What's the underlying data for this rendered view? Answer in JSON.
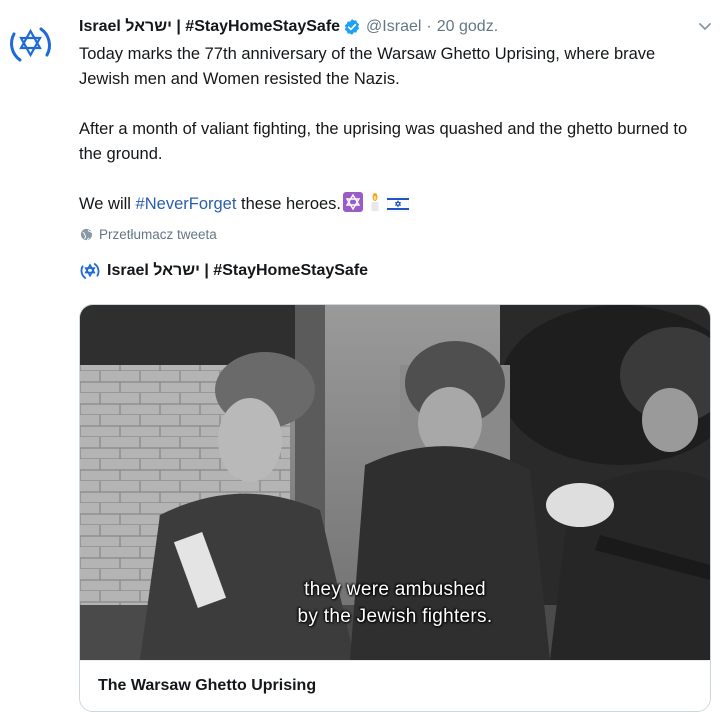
{
  "tweet": {
    "display_name": "Israel ישראל | #StayHomeStaySafe",
    "handle": "@Israel",
    "separator": "·",
    "time": "20 godz.",
    "paragraphs": {
      "p1": "Today marks the 77th anniversary of the Warsaw Ghetto Uprising, where brave Jewish men and Women resisted the Nazis.",
      "p2": "After a month of valiant fighting, the uprising was quashed and the ghetto burned to the ground.",
      "p3_prefix": "We will ",
      "p3_hashtag": "#NeverForget",
      "p3_suffix": " these heroes."
    },
    "emojis": [
      "star-of-david",
      "candle",
      "israel-flag"
    ],
    "translate_label": "Przetłumacz tweeta"
  },
  "quoted": {
    "author": "Israel ישראל | #StayHomeStaySafe",
    "video": {
      "subtitle_line1": "they were ambushed",
      "subtitle_line2": "by the Jewish fighters."
    },
    "card_title": "The Warsaw Ghetto Uprising"
  },
  "colors": {
    "brand_blue": "#1d6ad8",
    "verified_blue": "#1da1f2",
    "hashtag_blue": "#2a5db0",
    "muted_text": "#657786"
  }
}
